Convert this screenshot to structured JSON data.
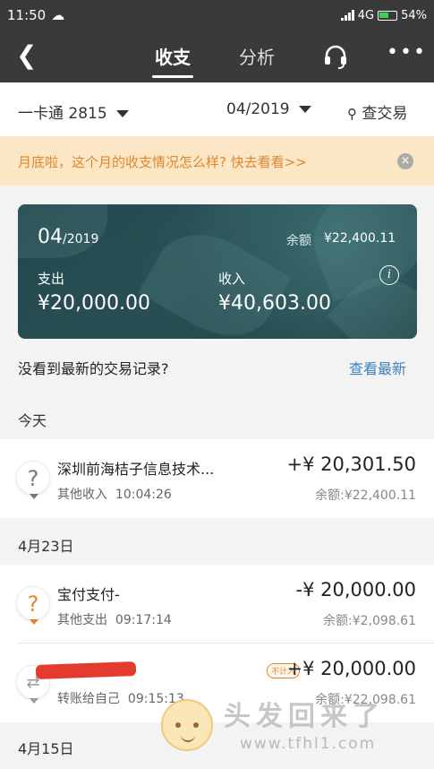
{
  "status_bar": {
    "time": "11:50",
    "network": "4G",
    "battery": "54%"
  },
  "nav": {
    "tab_active": "收支",
    "tab_other": "分析"
  },
  "filter": {
    "card": "一卡通 2815",
    "date": "04/2019",
    "search": "查交易"
  },
  "banner": {
    "text": "月底啦，这个月的收支情况怎么样? 快去看看>>"
  },
  "summary": {
    "month": "04",
    "year": "/2019",
    "balance_label": "余额",
    "balance": "¥22,400.11",
    "expense_label": "支出",
    "expense": "¥20,000.00",
    "income_label": "收入",
    "income": "¥40,603.00"
  },
  "prompt": {
    "text": "没看到最新的交易记录?",
    "link": "查看最新"
  },
  "sections": [
    {
      "date": "今天",
      "transactions": [
        {
          "title": "深圳前海桔子信息技术...",
          "category": "其他收入",
          "time": "10:04:26",
          "amount": "+¥ 20,301.50",
          "balance": "余额:¥22,400.11",
          "icon_color": "#777777"
        }
      ]
    },
    {
      "date": "4月23日",
      "transactions": [
        {
          "title": "宝付支付-",
          "category": "其他支出",
          "time": "09:17:14",
          "amount": "-¥ 20,000.00",
          "balance": "余额:¥2,098.61",
          "icon_color": "#e2852c"
        },
        {
          "title": "",
          "category": "转账给自己",
          "time": "09:15:13",
          "amount": "+¥ 20,000.00",
          "balance": "余额:¥22,098.61",
          "tag": "不计入",
          "icon_color": "#999999"
        }
      ]
    },
    {
      "date": "4月15日",
      "transactions": []
    }
  ],
  "watermark": {
    "big": "头发回来了",
    "small": "www.tfhl1.com"
  }
}
